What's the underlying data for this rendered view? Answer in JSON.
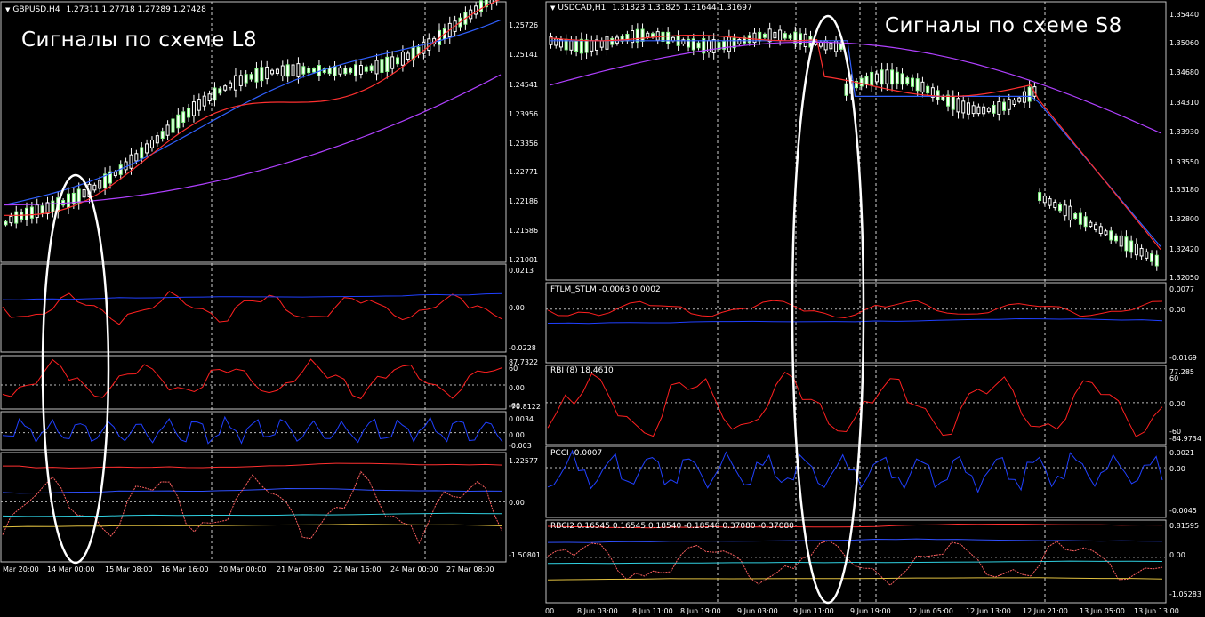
{
  "left": {
    "symbol": "GBPUSD,H4",
    "quote": "1.27311 1.27718 1.27289 1.27428",
    "caption": "Сигналы по схеме L8",
    "price_ticks": [
      "1.25726",
      "1.25141",
      "1.24541",
      "1.23956",
      "1.23356",
      "1.22771",
      "1.22186",
      "1.21586",
      "1.21001"
    ],
    "ind1_ticks": [
      "0.0213",
      "0.00",
      "-0.0228"
    ],
    "ind2_ticks": [
      "87.7322",
      "60",
      "0.00",
      "-60",
      "-70.8122"
    ],
    "ind3_ticks": [
      "0.0034",
      "0.00",
      "-0.003"
    ],
    "ind4_ticks": [
      "1.22577",
      "0.00",
      "-1.50801"
    ],
    "time_labels": [
      "Mar 20:00",
      "14 Mar 00:00",
      "15 Mar 08:00",
      "16 Mar 16:00",
      "20 Mar 00:00",
      "21 Mar 08:00",
      "22 Mar 16:00",
      "24 Mar 00:00",
      "27 Mar 08:00"
    ]
  },
  "right": {
    "symbol": "USDCAD,H1",
    "quote": "1.31823 1.31825 1.31644 1.31697",
    "caption": "Сигналы по схеме S8",
    "price_ticks": [
      "1.35440",
      "1.35060",
      "1.34680",
      "1.34310",
      "1.33930",
      "1.33550",
      "1.33180",
      "1.32800",
      "1.32420",
      "1.32050"
    ],
    "ind1_label": "FTLM_STLM -0.0063 0.0002",
    "ind1_ticks": [
      "0.0077",
      "0.00",
      "-0.0169"
    ],
    "ind2_label": "RBI (8) 18.4610",
    "ind2_ticks": [
      "77.285",
      "60",
      "0.00",
      "-60",
      "-84.9734"
    ],
    "ind3_label": "PCCI -0.0007",
    "ind3_ticks": [
      "0.0021",
      "0.00",
      "-0.0045"
    ],
    "ind4_label": "RBCI2 0.16545 0.16545 0.18540 -0.18540 0.37080 -0.37080",
    "ind4_ticks": [
      "0.81595",
      "0.00",
      "-1.05283"
    ],
    "time_labels": [
      "00",
      "8 Jun 03:00",
      "8 Jun 11:00",
      "8 Jun 19:00",
      "9 Jun 03:00",
      "9 Jun 11:00",
      "9 Jun 19:00",
      "12 Jun 05:00",
      "12 Jun 13:00",
      "12 Jun 21:00",
      "13 Jun 05:00",
      "13 Jun 13:00"
    ]
  }
}
